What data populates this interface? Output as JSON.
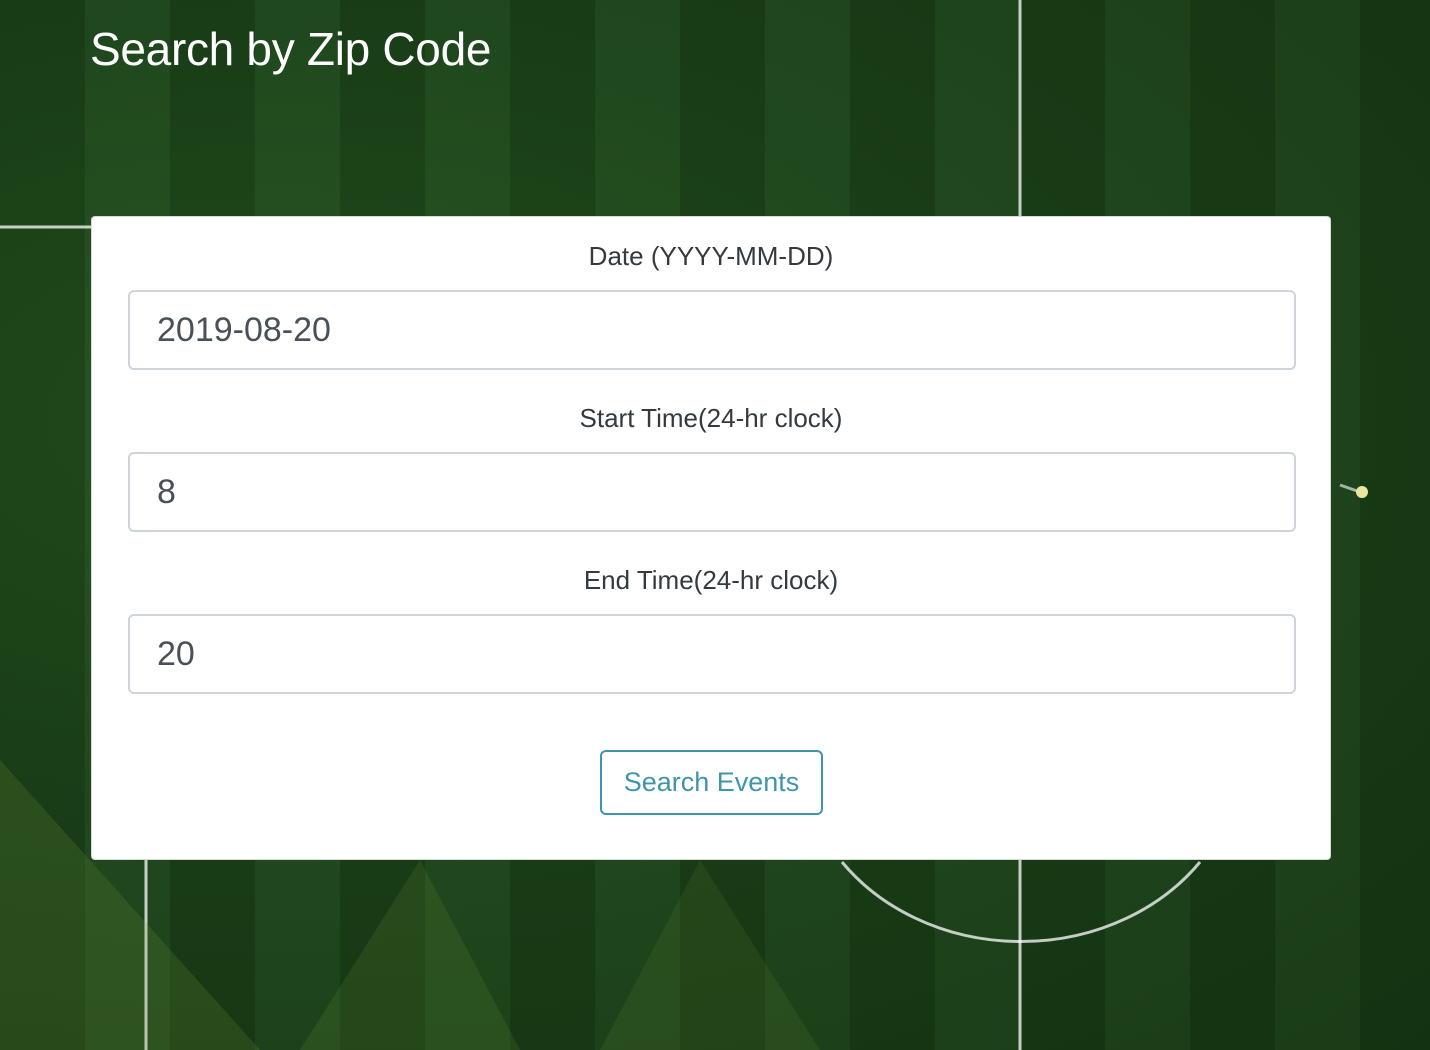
{
  "header": {
    "title": "Search by Zip Code"
  },
  "form": {
    "date": {
      "label": "Date (YYYY-MM-DD)",
      "value": "2019-08-20"
    },
    "start_time": {
      "label": "Start Time(24-hr clock)",
      "value": "8"
    },
    "end_time": {
      "label": "End Time(24-hr clock)",
      "value": "20"
    },
    "submit_label": "Search Events"
  },
  "colors": {
    "accent": "#3f96ab",
    "field_green": "#1f4a1c",
    "card_background": "#ffffff"
  }
}
